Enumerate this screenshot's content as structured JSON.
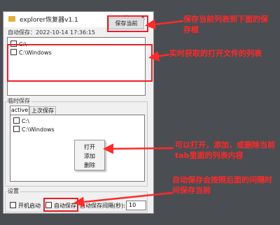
{
  "window": {
    "title": "explorer恢复器v1.1",
    "controls": {
      "minimize": "—",
      "maximize": "☐",
      "close": "✕"
    }
  },
  "top": {
    "save_button": "保存当前",
    "autosave_label": "自动保存：2022-10-14 17:36:15",
    "items": [
      {
        "text": "C:\\"
      },
      {
        "text": "C:\\Windows"
      }
    ]
  },
  "temp_save": {
    "label": "临时保存",
    "tabs": [
      "active",
      "上次保存"
    ],
    "items": [
      {
        "text": "C:\\"
      },
      {
        "text": "C:\\Windows"
      }
    ],
    "context_menu": [
      "打开",
      "添加",
      "删除"
    ]
  },
  "settings": {
    "label": "设置",
    "startup": "开机启动",
    "autosave": "自动保存",
    "interval_label": "自动保存间隔(秒):",
    "interval_value": "10"
  },
  "annotations": {
    "a1": "保存当前列表到下面的保存框",
    "a2": "实时获取的打开文件的列表",
    "a3": "可以打开，添加，或删除当前tab里面的列表内容",
    "a4": "自动保存会按照后面的间隔时间保存当前"
  },
  "colors": {
    "annotation": "#ff2a2a",
    "background": "#4a4d52",
    "window": "#f0f0f0"
  }
}
